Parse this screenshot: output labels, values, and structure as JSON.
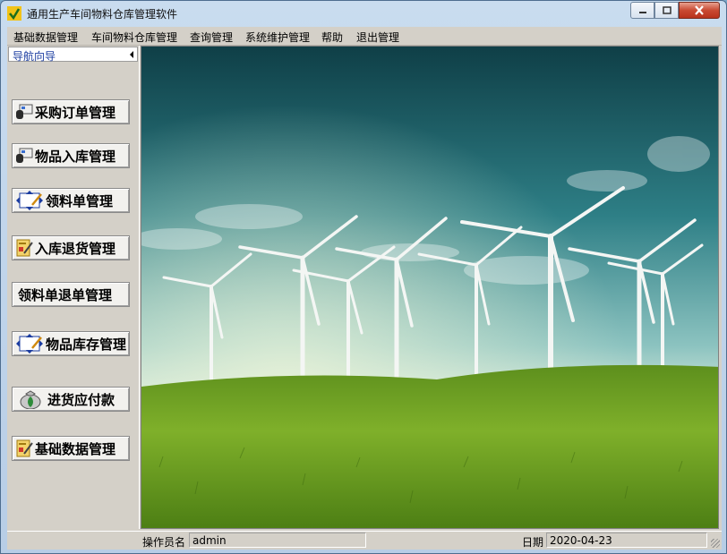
{
  "window": {
    "title": "通用生产车间物料仓库管理软件"
  },
  "menu": [
    "基础数据管理",
    "车间物料仓库管理",
    "查询管理",
    "系统维护管理",
    "帮助",
    "退出管理"
  ],
  "nav": {
    "header": "导航向导",
    "buttons": [
      {
        "label": "采购订单管理",
        "icon": "order-icon"
      },
      {
        "label": "物品入库管理",
        "icon": "stock-in-icon"
      },
      {
        "label": "领料单管理",
        "icon": "requisition-icon"
      },
      {
        "label": "入库退货管理",
        "icon": "return-icon"
      },
      {
        "label": "领料单退单管理",
        "icon": ""
      },
      {
        "label": "物品库存管理",
        "icon": "inventory-icon"
      },
      {
        "label": "进货应付款",
        "icon": "money-bag-icon"
      },
      {
        "label": "基础数据管理",
        "icon": "base-data-icon"
      }
    ]
  },
  "status": {
    "operator_label": "操作员名",
    "operator_value": "admin",
    "date_label": "日期",
    "date_value": "2020-04-23"
  },
  "colors": {
    "nav_header_text": "#1b3ca0",
    "panel_bg": "#d4d0c8"
  }
}
